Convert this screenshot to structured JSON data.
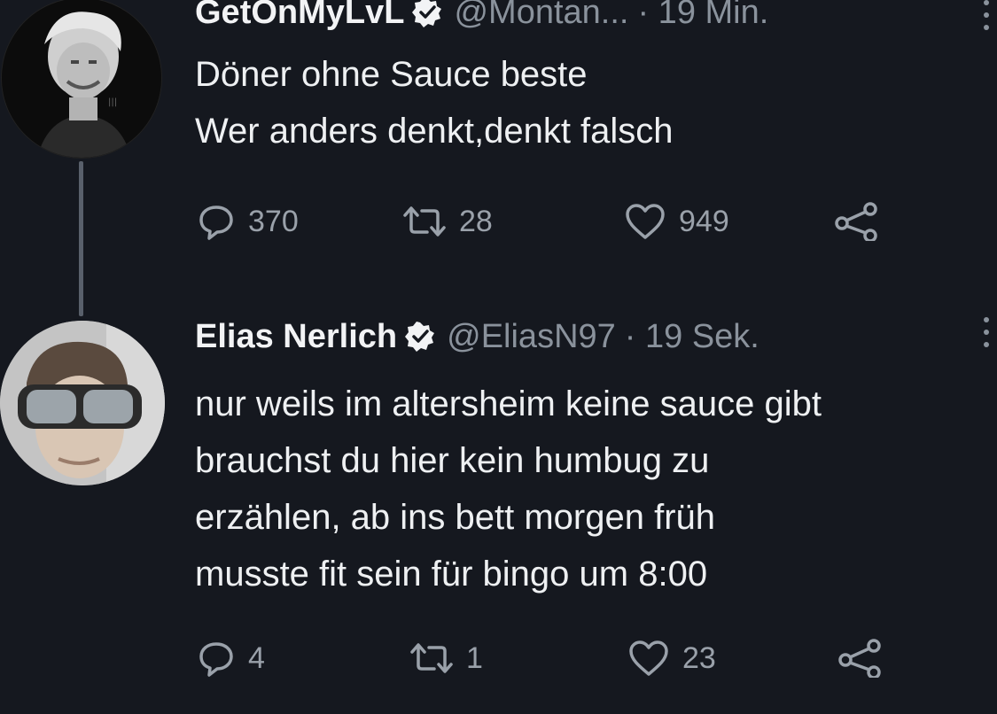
{
  "tweets": [
    {
      "display_name": "GetOnMyLvL",
      "verified": true,
      "handle": "@Montan...",
      "time": "· 19 Min.",
      "text_lines": [
        "Döner ohne Sauce beste",
        "Wer anders denkt,denkt falsch"
      ],
      "replies": "370",
      "retweets": "28",
      "likes": "949"
    },
    {
      "display_name": "Elias Nerlich",
      "verified": true,
      "handle": "@EliasN97",
      "time": "· 19 Sek.",
      "text_lines": [
        "nur weils im altersheim keine sauce gibt",
        "brauchst du hier kein humbug zu",
        "erzählen, ab ins bett morgen früh",
        "musste fit sein für bingo um 8:00"
      ],
      "replies": "4",
      "retweets": "1",
      "likes": "23"
    }
  ],
  "icons": {
    "reply": "reply-icon",
    "retweet": "retweet-icon",
    "like": "heart-icon",
    "share": "share-icon",
    "verified": "verified-badge-icon",
    "more": "more-icon"
  },
  "colors": {
    "background": "#15181f",
    "text": "#eef0f2",
    "muted": "#8a929c",
    "thread_line": "#59606b"
  }
}
